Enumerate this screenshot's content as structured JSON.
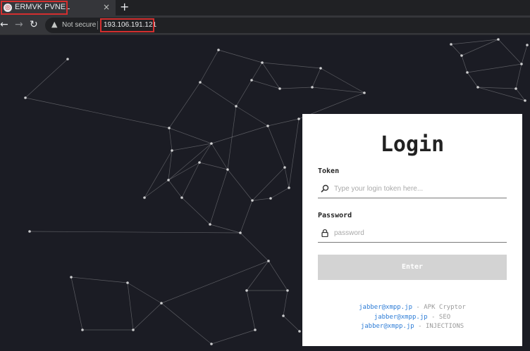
{
  "browser": {
    "tab": {
      "title": "ERMVK PVNEL",
      "favicon": "shield-icon",
      "close": "×"
    },
    "new_tab": "+",
    "nav": {
      "back": "←",
      "forward": "→",
      "reload": "↻"
    },
    "security": {
      "icon": "warning-icon",
      "glyph": "▲",
      "label": "Not secure"
    },
    "url": "193.106.191.121"
  },
  "login": {
    "title": "Login",
    "token": {
      "label": "Token",
      "placeholder": "Type your login token here...",
      "icon": "search-icon"
    },
    "password": {
      "label": "Password",
      "placeholder": "password",
      "icon": "lock-icon"
    },
    "submit_label": "Enter",
    "contacts": [
      {
        "jid": "jabber@xmpp.jp",
        "separator": " - ",
        "service": "APK Cryptor"
      },
      {
        "jid": "jabber@xmpp.jp",
        "separator": " - ",
        "service": "SEO"
      },
      {
        "jid": "jabber@xmpp.jp",
        "separator": " - ",
        "service": "INJECTIONS"
      }
    ]
  },
  "colors": {
    "background": "#1b1c24",
    "network_line": "#ffffff",
    "highlight_border": "#d32f2f",
    "link": "#2b7bd6",
    "button": "#d3d3d3"
  }
}
